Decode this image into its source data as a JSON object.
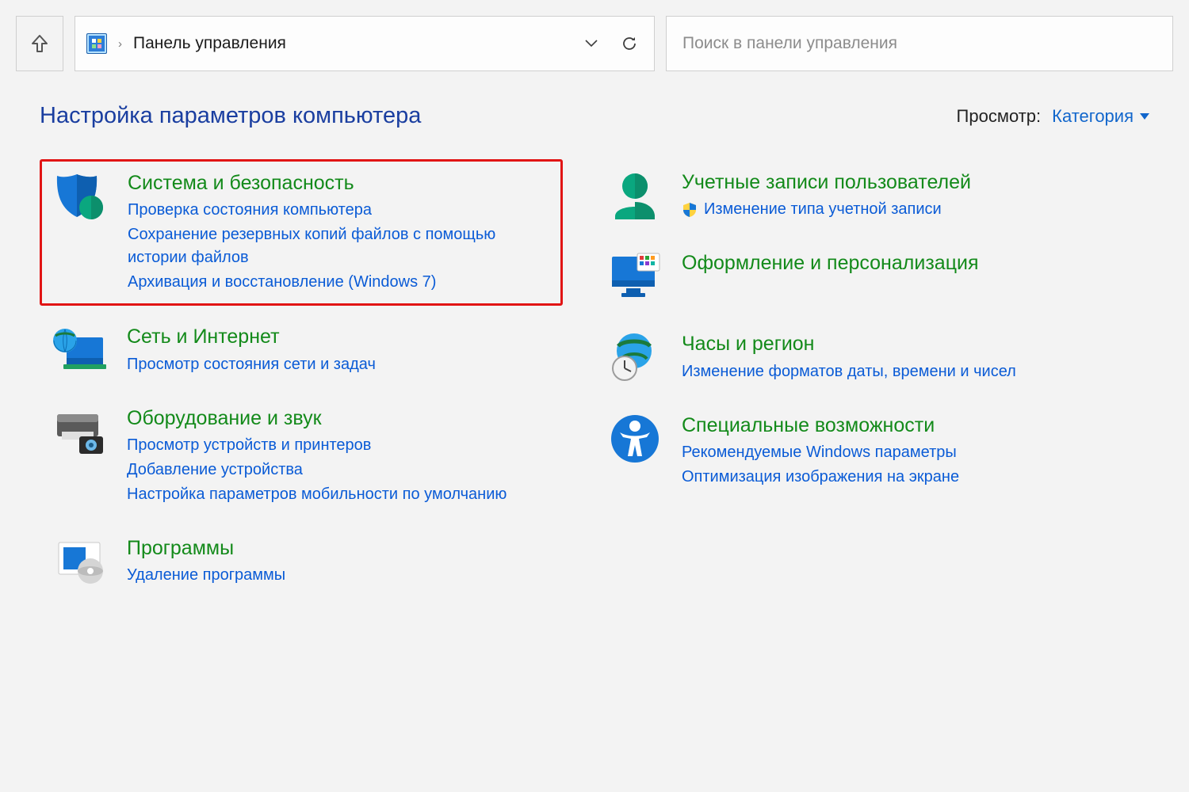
{
  "addressbar": {
    "location": "Панель управления"
  },
  "search": {
    "placeholder": "Поиск в панели управления"
  },
  "header": {
    "title": "Настройка параметров компьютера",
    "view_label": "Просмотр:",
    "view_value": "Категория"
  },
  "categories": {
    "system_security": {
      "title": "Система и безопасность",
      "links": [
        "Проверка состояния компьютера",
        "Сохранение резервных копий файлов с помощью истории файлов",
        "Архивация и восстановление (Windows 7)"
      ]
    },
    "network": {
      "title": "Сеть и Интернет",
      "links": [
        "Просмотр состояния сети и задач"
      ]
    },
    "hardware": {
      "title": "Оборудование и звук",
      "links": [
        "Просмотр устройств и принтеров",
        "Добавление устройства",
        "Настройка параметров мобильности по умолчанию"
      ]
    },
    "programs": {
      "title": "Программы",
      "links": [
        "Удаление программы"
      ]
    },
    "users": {
      "title": "Учетные записи пользователей",
      "links": [
        "Изменение типа учетной записи"
      ]
    },
    "appearance": {
      "title": "Оформление и персонализация",
      "links": []
    },
    "clock": {
      "title": "Часы и регион",
      "links": [
        "Изменение форматов даты, времени и чисел"
      ]
    },
    "ease": {
      "title": "Специальные возможности",
      "links": [
        "Рекомендуемые Windows параметры",
        "Оптимизация изображения на экране"
      ]
    }
  }
}
